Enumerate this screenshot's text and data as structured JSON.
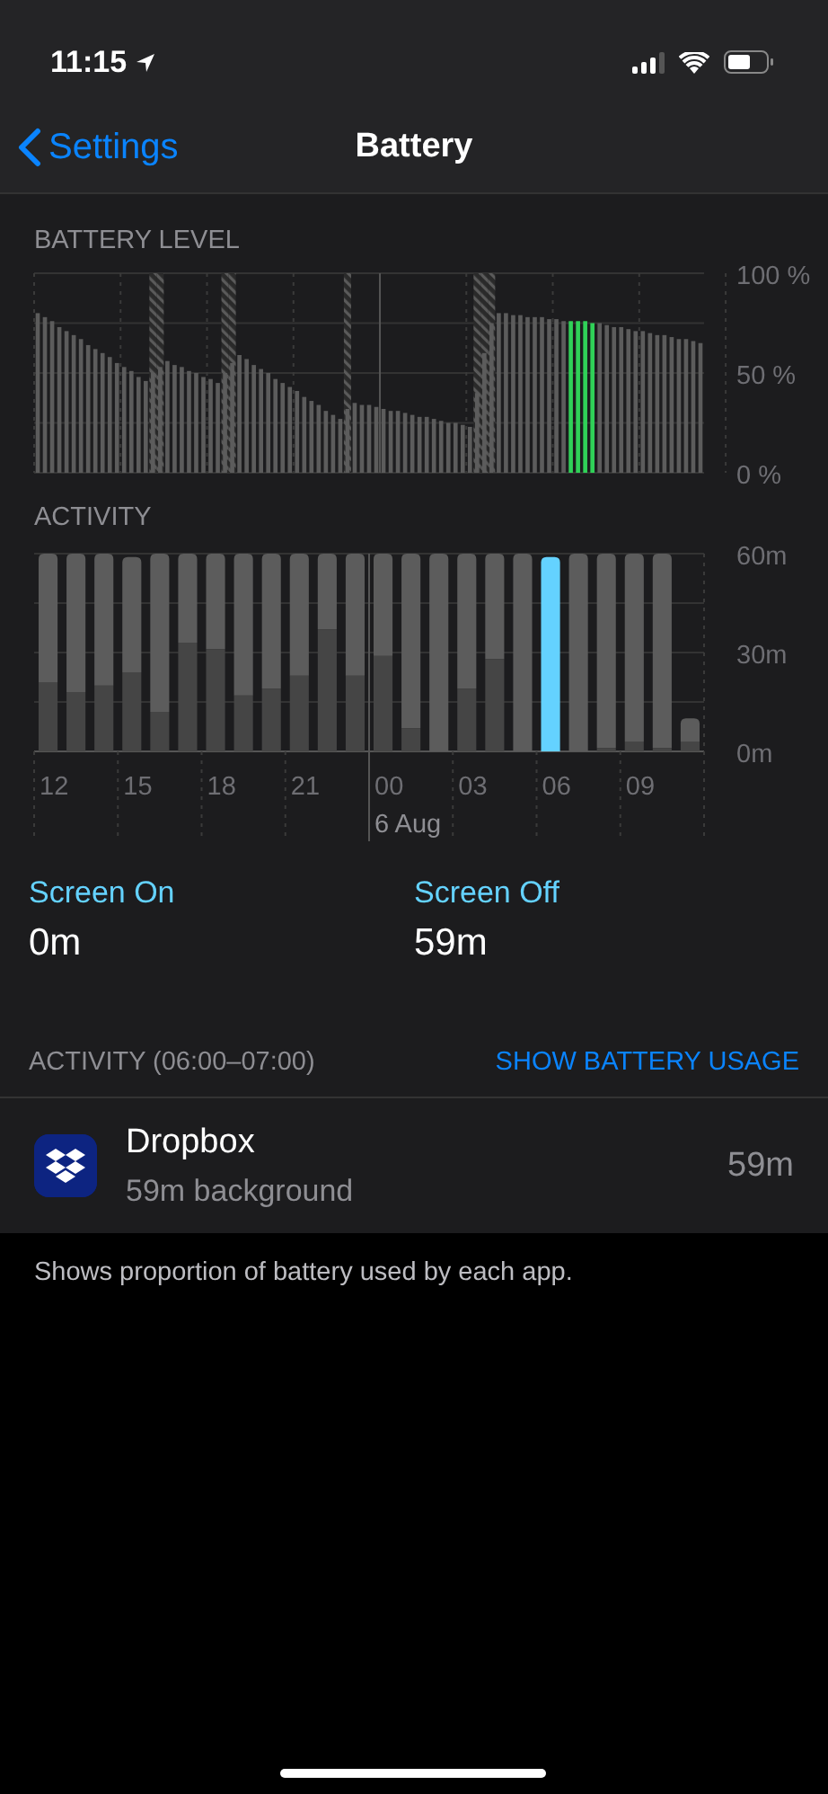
{
  "status_bar": {
    "time": "11:15"
  },
  "nav": {
    "back": "Settings",
    "title": "Battery"
  },
  "battery_level": {
    "title": "BATTERY LEVEL",
    "chart_data": {
      "type": "bar",
      "ylim": [
        0,
        100
      ],
      "yticks": [
        {
          "value": 0,
          "label": "0 %"
        },
        {
          "value": 50,
          "label": "50 %"
        },
        {
          "value": 100,
          "label": "100 %"
        }
      ],
      "series": [
        {
          "color": "#5a5a5a",
          "values": [
            null,
            null,
            null,
            null,
            null,
            null,
            null,
            null,
            null,
            null,
            null,
            null,
            null,
            null,
            null,
            null,
            100,
            100,
            null,
            null,
            null,
            null,
            null,
            null,
            null,
            null,
            100,
            100,
            null,
            null,
            null,
            null,
            null,
            null,
            null,
            null,
            null,
            null,
            null,
            null,
            null,
            null,
            null,
            100,
            null,
            null,
            null,
            null,
            null,
            null,
            null,
            null,
            null,
            null,
            null,
            null,
            null,
            null,
            null,
            null,
            null,
            100,
            100,
            100,
            null,
            null,
            null,
            null,
            null,
            null,
            null,
            null,
            null,
            null,
            null,
            null,
            null,
            null,
            null,
            null,
            null,
            null,
            null,
            null,
            null,
            null,
            null,
            null,
            null,
            null,
            null,
            null,
            null
          ]
        },
        {
          "color": "#5c5c5c",
          "values": [
            80,
            78,
            76,
            73,
            71,
            69,
            67,
            64,
            62,
            60,
            58,
            55,
            53,
            51,
            48,
            46,
            50,
            53,
            56,
            54,
            53,
            51,
            50,
            48,
            47,
            45,
            50,
            55,
            59,
            57,
            54,
            52,
            50,
            47,
            45,
            43,
            41,
            38,
            36,
            34,
            31,
            29,
            27,
            32,
            35,
            34,
            34,
            33,
            32,
            31,
            31,
            30,
            29,
            28,
            28,
            27,
            26,
            25,
            25,
            24,
            23,
            40,
            60,
            75,
            80,
            80,
            79,
            79,
            78,
            78,
            78,
            77,
            77,
            76,
            null,
            null,
            null,
            null,
            75,
            74,
            73,
            73,
            72,
            71,
            71,
            70,
            69,
            69,
            68,
            67,
            67,
            66,
            65
          ]
        },
        {
          "color": "#30d158",
          "values": [
            null,
            null,
            null,
            null,
            null,
            null,
            null,
            null,
            null,
            null,
            null,
            null,
            null,
            null,
            null,
            null,
            null,
            null,
            null,
            null,
            null,
            null,
            null,
            null,
            null,
            null,
            null,
            null,
            null,
            null,
            null,
            null,
            null,
            null,
            null,
            null,
            null,
            null,
            null,
            null,
            null,
            null,
            null,
            null,
            null,
            null,
            null,
            null,
            null,
            null,
            null,
            null,
            null,
            null,
            null,
            null,
            null,
            null,
            null,
            null,
            null,
            null,
            null,
            null,
            null,
            null,
            null,
            null,
            null,
            null,
            null,
            null,
            null,
            null,
            76,
            76,
            76,
            75,
            null,
            null,
            null,
            null,
            null,
            null,
            null,
            null,
            null,
            null,
            null,
            null,
            null,
            null,
            null
          ]
        }
      ]
    }
  },
  "activity": {
    "title": "ACTIVITY",
    "date_label": "6 Aug",
    "chart_data": {
      "type": "bar",
      "stacked": true,
      "ylim": [
        0,
        60
      ],
      "categories": [
        "12",
        null,
        null,
        "15",
        null,
        null,
        "18",
        null,
        null,
        "21",
        null,
        null,
        "00",
        null,
        null,
        "03",
        null,
        null,
        "06",
        null,
        null,
        "09",
        null,
        null
      ],
      "yticks": [
        {
          "value": 0,
          "label": "0m"
        },
        {
          "value": 30,
          "label": "30m"
        },
        {
          "value": 60,
          "label": "60m"
        }
      ],
      "series": [
        {
          "color": "#454545",
          "values": [
            21,
            18,
            20,
            24,
            12,
            33,
            31,
            17,
            19,
            23,
            37,
            23,
            29,
            7,
            0,
            19,
            28,
            0,
            0,
            0,
            1,
            3,
            1,
            3
          ]
        },
        {
          "color": "#5c5c5c",
          "values": [
            39,
            42,
            40,
            35,
            48,
            27,
            29,
            43,
            41,
            37,
            23,
            37,
            31,
            53,
            60,
            41,
            32,
            60,
            null,
            60,
            59,
            57,
            59,
            7
          ]
        },
        {
          "color": "#64d2ff",
          "values": [
            null,
            null,
            null,
            null,
            null,
            null,
            null,
            null,
            null,
            null,
            null,
            null,
            null,
            null,
            null,
            null,
            null,
            null,
            59,
            null,
            null,
            null,
            null,
            null
          ]
        }
      ]
    }
  },
  "screen_time": [
    {
      "label": "Screen On",
      "value": "0m"
    },
    {
      "label": "Screen Off",
      "value": "59m"
    }
  ],
  "usage_header": {
    "title": "ACTIVITY (06:00–07:00)",
    "action": "SHOW BATTERY USAGE"
  },
  "apps": [
    {
      "name": "Dropbox",
      "detail": "59m background",
      "value": "59m"
    }
  ],
  "footer": "Shows proportion of battery used by each app."
}
